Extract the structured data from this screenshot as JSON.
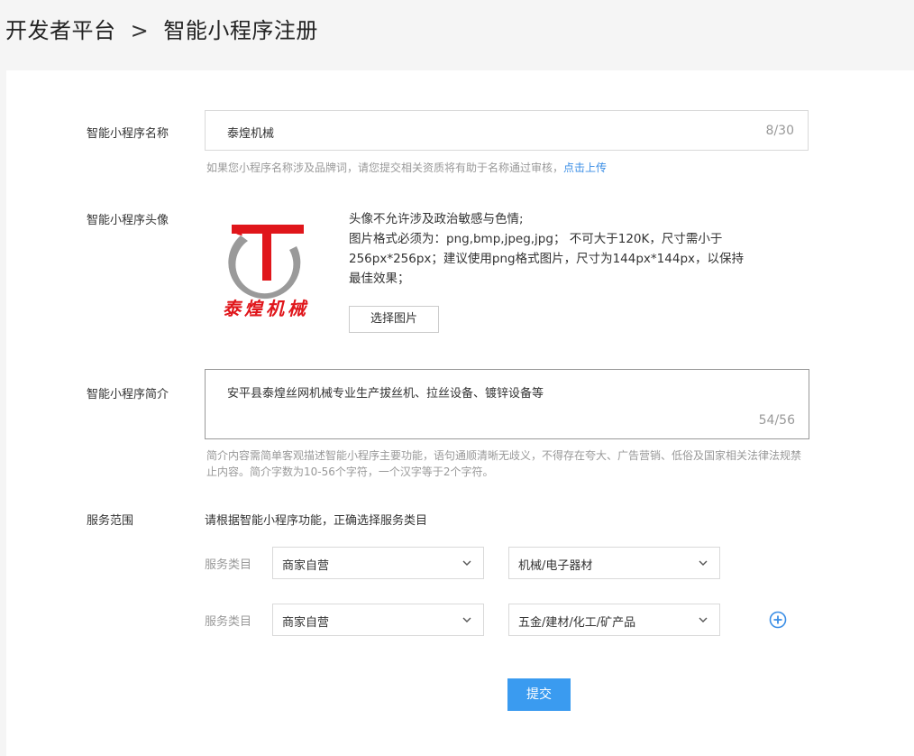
{
  "breadcrumb": {
    "root": "开发者平台",
    "separator": ">",
    "current": "智能小程序注册"
  },
  "form": {
    "name": {
      "label": "智能小程序名称",
      "value": "泰煌机械",
      "counter": "8/30",
      "hint_text": "如果您小程序名称涉及品牌词，请您提交相关资质将有助于名称通过审核，",
      "hint_link": "点击上传"
    },
    "avatar": {
      "label": "智能小程序头像",
      "logo_letter": "T",
      "logo_text": "泰煌机械",
      "desc_line1": "头像不允许涉及政治敏感与色情;",
      "desc_line2": "图片格式必须为：png,bmp,jpeg,jpg； 不可大于120K，尺寸需小于",
      "desc_line3": "256px*256px；建议使用png格式图片，尺寸为144px*144px，以保持",
      "desc_line4": "最佳效果；",
      "choose_button": "选择图片"
    },
    "intro": {
      "label": "智能小程序简介",
      "value": "安平县泰煌丝网机械专业生产拔丝机、拉丝设备、镀锌设备等",
      "counter": "54/56",
      "hint_line1": "简介内容需简单客观描述智能小程序主要功能，语句通顺清晰无歧义，不得存在夸大、广告营销、低俗及国家相关法律法规禁",
      "hint_line2": "止内容。简介字数为10-56个字符，一个汉字等于2个字符。"
    },
    "service": {
      "label": "服务范围",
      "tip": "请根据智能小程序功能，正确选择服务类目",
      "rows": [
        {
          "label": "服务类目",
          "primary": "商家自营",
          "secondary": "机械/电子器材"
        },
        {
          "label": "服务类目",
          "primary": "商家自营",
          "secondary": "五金/建材/化工/矿产品"
        }
      ]
    },
    "submit_label": "提交"
  },
  "colors": {
    "accent": "#3a9bf0",
    "link": "#3a8ee6",
    "logo_red": "#e0161b",
    "logo_gray": "#9a9a9a"
  }
}
